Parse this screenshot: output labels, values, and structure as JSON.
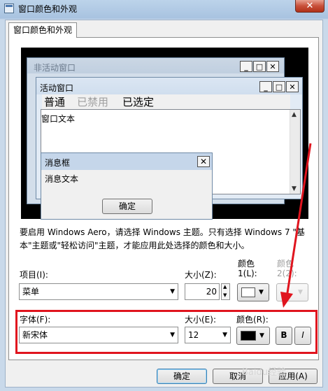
{
  "window": {
    "title": "窗口颜色和外观",
    "close_glyph": "✕"
  },
  "tab": {
    "label": "窗口颜色和外观"
  },
  "preview": {
    "inactive_title": "非活动窗口",
    "active_title": "活动窗口",
    "menu_normal": "普通",
    "menu_disabled": "已禁用",
    "menu_selected": "已选定",
    "window_text": "窗口文本",
    "msgbox_title": "消息框",
    "msgbox_text": "消息文本",
    "msgbox_ok": "确定",
    "caption_buttons": [
      "_",
      "□",
      "✕"
    ]
  },
  "description": "要启用 Windows Aero，请选择 Windows 主题。只有选择 Windows 7 \"基本\"主题或\"轻松访问\"主题，才能应用此处选择的颜色和大小。",
  "item_row": {
    "item_label": "项目(I):",
    "item_value": "菜单",
    "size_label": "大小(Z):",
    "size_value": "20",
    "color1_label_top": "颜色",
    "color1_label": "1(L):",
    "color1_value": "#ffffff",
    "color2_label_top": "颜色",
    "color2_label": "2(2):"
  },
  "font_row": {
    "font_label": "字体(F):",
    "font_value": "新宋体",
    "font_size_label": "大小(E):",
    "font_size_value": "12",
    "font_color_label": "颜色(R):",
    "font_color_value": "#000000",
    "bold_label": "B",
    "italic_label": "I"
  },
  "buttons": {
    "ok": "确定",
    "cancel": "取消",
    "apply": "应用(A)"
  },
  "watermark": "Baidu经验",
  "annotation": {
    "highlight_color": "#e0141e"
  }
}
